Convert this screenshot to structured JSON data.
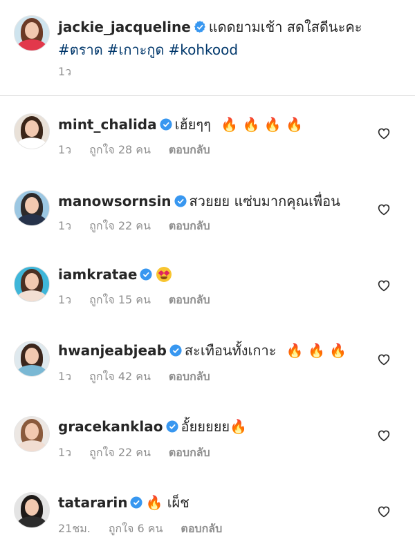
{
  "post": {
    "username": "jackie_jacqueline",
    "caption": "แดดยามเช้า สดใสดีนะคะ",
    "hashtags": [
      "#ตราด",
      "#เกาะกูด",
      "#kohkood"
    ],
    "time": "1ว"
  },
  "icons": {
    "verified": "verified-badge-icon",
    "heart": "heart-outline-icon",
    "fire": "🔥"
  },
  "colors": {
    "verified": "#3897f0",
    "hashtag": "#00376b",
    "meta": "#8e8e8e"
  },
  "comments": [
    {
      "username": "mint_chalida",
      "text": "เฮ้ยๆๆ",
      "fires": 4,
      "time": "1ว",
      "likes": "ถูกใจ 28 คน",
      "reply": "ตอบกลับ"
    },
    {
      "username": "manowsornsin",
      "text": "สวยยย แซ่บมากคุณเพื่อน",
      "fires": 0,
      "time": "1ว",
      "likes": "ถูกใจ 22 คน",
      "reply": "ตอบกลับ"
    },
    {
      "username": "iamkratae",
      "text": "",
      "fires": 0,
      "emoji": "heart-eyes",
      "time": "1ว",
      "likes": "ถูกใจ 15 คน",
      "reply": "ตอบกลับ"
    },
    {
      "username": "hwanjeabjeab",
      "text": "สะเทือนทั้งเกาะ",
      "fires": 3,
      "time": "1ว",
      "likes": "ถูกใจ 42 คน",
      "reply": "ตอบกลับ"
    },
    {
      "username": "gracekanklao",
      "text": "อั้ยยยยย",
      "fires": 1,
      "time": "1ว",
      "likes": "ถูกใจ 22 คน",
      "reply": "ตอบกลับ"
    },
    {
      "username": "tatararin",
      "text": "เผ็ช",
      "fires": 1,
      "fire_first": true,
      "time": "21ชม.",
      "likes": "ถูกใจ 6 คน",
      "reply": "ตอบกลับ"
    }
  ]
}
